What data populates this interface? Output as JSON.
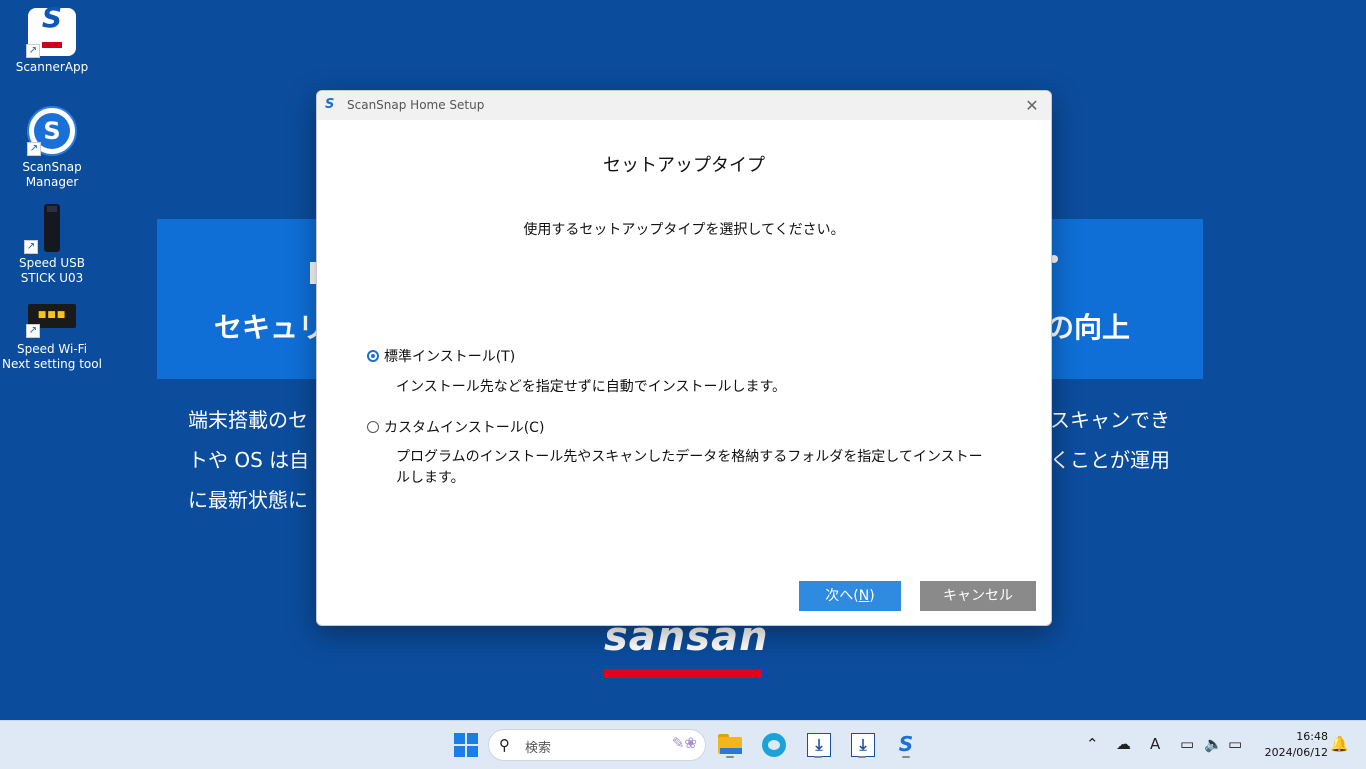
{
  "desktop": {
    "icons": [
      {
        "label": "ScannerApp",
        "icon": "scannerapp-icon"
      },
      {
        "label": "ScanSnap Manager",
        "icon": "scansnap-manager-icon"
      },
      {
        "label": "Speed USB STICK U03",
        "icon": "usb-stick-icon"
      },
      {
        "label": "Speed Wi-Fi Next setting tool",
        "icon": "wifi-router-icon"
      }
    ],
    "background": {
      "banner_left": "セキュリ",
      "banner_right": "の向上",
      "line1_left": "端末搭載のセ",
      "line1_right": "スキャンでき",
      "line2_left": "トや OS は自",
      "line2_right": "くことが運用",
      "line3_left": "に最新状態に",
      "line3_right": "。",
      "logo": "sansan",
      "brand_color": "#0f6fd6",
      "accent_red": "#e2001a"
    }
  },
  "dialog": {
    "title": "ScanSnap Home Setup",
    "close_glyph": "✕",
    "heading": "セットアップタイプ",
    "subheading": "使用するセットアップタイプを選択してください。",
    "options": [
      {
        "label": "標準インストール(T)",
        "description": "インストール先などを指定せずに自動でインストールします。",
        "selected": true
      },
      {
        "label": "カスタムインストール(C)",
        "description": "プログラムのインストール先やスキャンしたデータを格納するフォルダを指定してインストールします。",
        "selected": false
      }
    ],
    "next_label": "次へ(",
    "next_accel": "N",
    "next_close": ")",
    "cancel_label": "キャンセル",
    "accent_color": "#2f8be0"
  },
  "taskbar": {
    "search_placeholder": "検索",
    "pinned": [
      "windows-start-icon",
      "file-explorer-icon",
      "edge-icon",
      "scanner-app-icon",
      "scanner-app-icon",
      "scansnap-icon"
    ],
    "tray": {
      "ime": "A"
    },
    "clock": {
      "time": "16:48",
      "date": "2024/06/12"
    }
  }
}
